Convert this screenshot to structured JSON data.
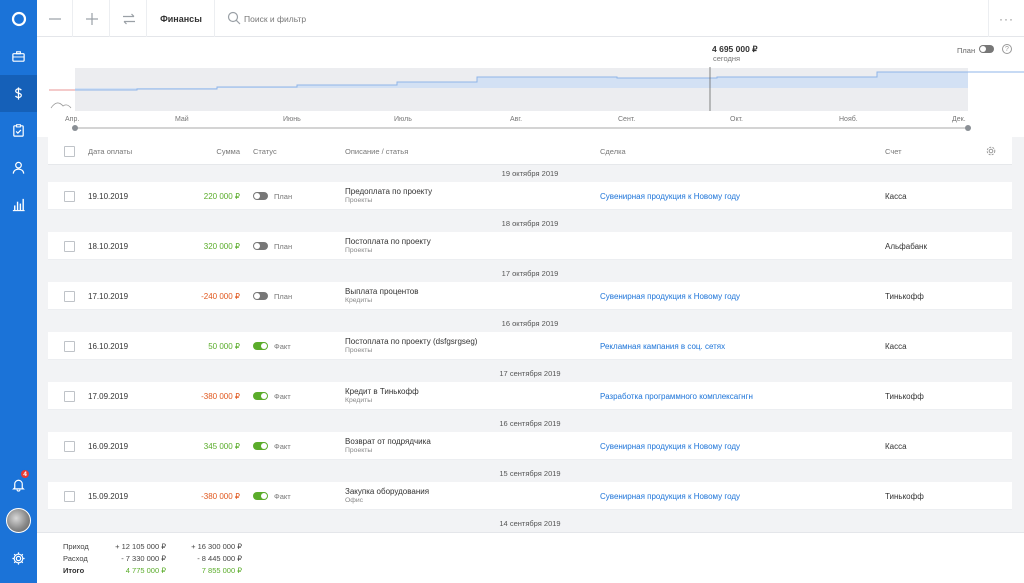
{
  "sidebar": {
    "items": [
      {
        "name": "briefcase-icon"
      },
      {
        "name": "dollar-icon"
      },
      {
        "name": "checklist-icon"
      },
      {
        "name": "user-icon"
      },
      {
        "name": "bar-chart-icon"
      }
    ],
    "notifications_badge": "4"
  },
  "topbar": {
    "title": "Финансы",
    "search_placeholder": "Поиск и фильтр",
    "more": "···"
  },
  "chart": {
    "total": "4 695 000 ₽",
    "today_label": "сегодня",
    "plan_label": "План",
    "help": "?",
    "months": [
      "Апр.",
      "Май",
      "Июнь",
      "Июль",
      "Авг.",
      "Сент.",
      "Окт.",
      "Нояб.",
      "Дек."
    ]
  },
  "table": {
    "headers": {
      "date": "Дата оплаты",
      "sum": "Сумма",
      "status": "Статус",
      "description": "Описание / статья",
      "deal": "Сделка",
      "account": "Счет"
    },
    "groups": [
      {
        "date": "19 октября 2019",
        "row": {
          "date": "19.10.2019",
          "sum": "220 000 ₽",
          "sign": "pos",
          "fact": false,
          "status": "План",
          "desc": "Предоплата по проекту",
          "cat": "Проекты",
          "deal": "Сувенирная продукция к Новому году",
          "account": "Касса"
        }
      },
      {
        "date": "18 октября 2019",
        "row": {
          "date": "18.10.2019",
          "sum": "320 000 ₽",
          "sign": "pos",
          "fact": false,
          "status": "План",
          "desc": "Постоплата по проекту",
          "cat": "Проекты",
          "deal": "",
          "account": "Альфабанк"
        }
      },
      {
        "date": "17 октября 2019",
        "row": {
          "date": "17.10.2019",
          "sum": "-240 000 ₽",
          "sign": "neg",
          "fact": false,
          "status": "План",
          "desc": "Выплата процентов",
          "cat": "Кредиты",
          "deal": "Сувенирная продукция к Новому году",
          "account": "Тинькофф"
        }
      },
      {
        "date": "16 октября 2019",
        "row": {
          "date": "16.10.2019",
          "sum": "50 000 ₽",
          "sign": "pos",
          "fact": true,
          "status": "Факт",
          "desc": "Постоплата по проекту (dsfgsrgseg)",
          "cat": "Проекты",
          "deal": "Рекламная кампания в соц. сетях",
          "account": "Касса"
        }
      },
      {
        "date": "17 сентября 2019",
        "row": {
          "date": "17.09.2019",
          "sum": "-380 000 ₽",
          "sign": "neg",
          "fact": true,
          "status": "Факт",
          "desc": "Кредит в Тинькофф",
          "cat": "Кредиты",
          "deal": "Разработка программного комплексагнгн",
          "account": "Тинькофф"
        }
      },
      {
        "date": "16 сентября 2019",
        "row": {
          "date": "16.09.2019",
          "sum": "345 000 ₽",
          "sign": "pos",
          "fact": true,
          "status": "Факт",
          "desc": "Возврат от подрядчика",
          "cat": "Проекты",
          "deal": "Сувенирная продукция к Новому году",
          "account": "Касса"
        }
      },
      {
        "date": "15 сентября 2019",
        "row": {
          "date": "15.09.2019",
          "sum": "-380 000 ₽",
          "sign": "neg",
          "fact": true,
          "status": "Факт",
          "desc": "Закупка оборудования",
          "cat": "Офис",
          "deal": "Сувенирная продукция к Новому году",
          "account": "Тинькофф"
        }
      },
      {
        "date": "14 сентября 2019",
        "row": null
      }
    ]
  },
  "footer": {
    "income_label": "Приход",
    "expense_label": "Расход",
    "total_label": "Итого",
    "income_a": "+ 12 105 000 ₽",
    "expense_a": "- 7 330 000 ₽",
    "total_a": "4 775 000 ₽",
    "income_b": "+ 16 300 000 ₽",
    "expense_b": "- 8 445 000 ₽",
    "total_b": "7 855 000 ₽"
  },
  "colors": {
    "sidebar": "#1b73d8",
    "positive": "#5aac2a",
    "negative": "#e0581e",
    "link": "#1b73d8"
  }
}
